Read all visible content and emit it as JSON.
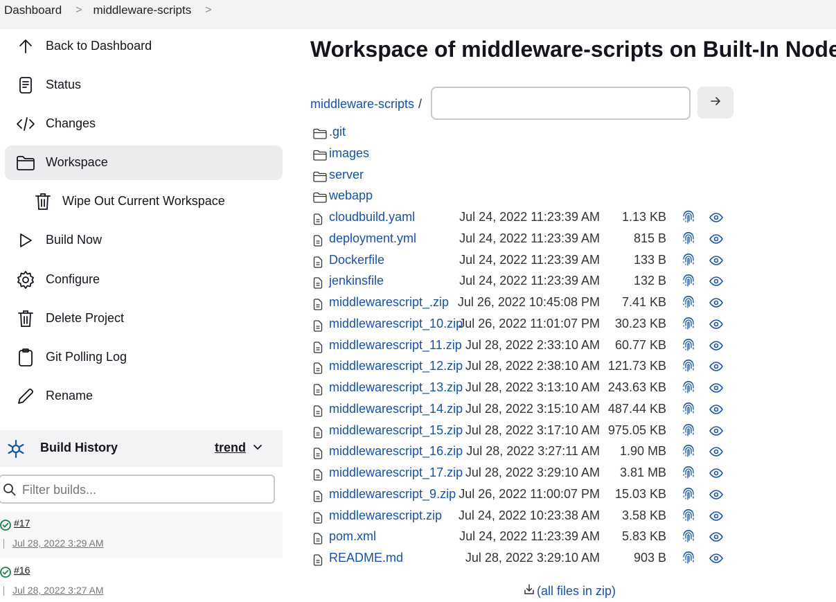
{
  "breadcrumb": {
    "items": [
      "Dashboard",
      "middleware-scripts"
    ],
    "separator": ">"
  },
  "sidebar": {
    "items": [
      {
        "label": "Back to Dashboard",
        "icon": "arrow-up-icon"
      },
      {
        "label": "Status",
        "icon": "document-icon"
      },
      {
        "label": "Changes",
        "icon": "code-icon"
      },
      {
        "label": "Workspace",
        "icon": "folder-icon"
      },
      {
        "label": "Wipe Out Current Workspace",
        "icon": "trash-icon"
      },
      {
        "label": "Build Now",
        "icon": "play-icon"
      },
      {
        "label": "Configure",
        "icon": "gear-icon"
      },
      {
        "label": "Delete Project",
        "icon": "trash-icon"
      },
      {
        "label": "Git Polling Log",
        "icon": "clipboard-icon"
      },
      {
        "label": "Rename",
        "icon": "pencil-icon"
      }
    ],
    "active": "Workspace"
  },
  "build_history": {
    "title": "Build History",
    "trend_label": "trend",
    "filter_placeholder": "Filter builds...",
    "builds": [
      {
        "number": "#17",
        "date": "Jul 28, 2022 3:29 AM",
        "status": "success"
      },
      {
        "number": "#16",
        "date": "Jul 28, 2022 3:27 AM",
        "status": "success"
      }
    ]
  },
  "main": {
    "title": "Workspace of middleware-scripts on Built-In Node",
    "root_link": "middleware-scripts",
    "path_separator": "/",
    "path_input_value": "",
    "folders": [
      ".git",
      "images",
      "server",
      "webapp"
    ],
    "files": [
      {
        "name": "cloudbuild.yaml",
        "date": "Jul 24, 2022 11:23:39 AM",
        "size": "1.13 KB"
      },
      {
        "name": "deployment.yml",
        "date": "Jul 24, 2022 11:23:39 AM",
        "size": "815 B"
      },
      {
        "name": "Dockerfile",
        "date": "Jul 24, 2022 11:23:39 AM",
        "size": "133 B"
      },
      {
        "name": "jenkinsfile",
        "date": "Jul 24, 2022 11:23:39 AM",
        "size": "132 B"
      },
      {
        "name": "middlewarescript_.zip",
        "date": "Jul 26, 2022 10:45:08 PM",
        "size": "7.41 KB"
      },
      {
        "name": "middlewarescript_10.zip",
        "date": "Jul 26, 2022 11:01:07 PM",
        "size": "30.23 KB"
      },
      {
        "name": "middlewarescript_11.zip",
        "date": "Jul 28, 2022 2:33:10 AM",
        "size": "60.77 KB"
      },
      {
        "name": "middlewarescript_12.zip",
        "date": "Jul 28, 2022 2:38:10 AM",
        "size": "121.73 KB"
      },
      {
        "name": "middlewarescript_13.zip",
        "date": "Jul 28, 2022 3:13:10 AM",
        "size": "243.63 KB"
      },
      {
        "name": "middlewarescript_14.zip",
        "date": "Jul 28, 2022 3:15:10 AM",
        "size": "487.44 KB"
      },
      {
        "name": "middlewarescript_15.zip",
        "date": "Jul 28, 2022 3:17:10 AM",
        "size": "975.05 KB"
      },
      {
        "name": "middlewarescript_16.zip",
        "date": "Jul 28, 2022 3:27:11 AM",
        "size": "1.90 MB"
      },
      {
        "name": "middlewarescript_17.zip",
        "date": "Jul 28, 2022 3:29:10 AM",
        "size": "3.81 MB"
      },
      {
        "name": "middlewarescript_9.zip",
        "date": "Jul 26, 2022 11:00:07 PM",
        "size": "15.03 KB"
      },
      {
        "name": "middlewarescript.zip",
        "date": "Jul 24, 2022 10:23:38 AM",
        "size": "3.58 KB"
      },
      {
        "name": "pom.xml",
        "date": "Jul 24, 2022 11:23:39 AM",
        "size": "5.83 KB"
      },
      {
        "name": "README.md",
        "date": "Jul 28, 2022 3:29:10 AM",
        "size": "903 B"
      }
    ],
    "zip_link": "(all files in zip)"
  },
  "colors": {
    "link": "#1652a6",
    "success": "#138347",
    "sidebar_active_bg": "#ececef",
    "header_bg": "#f3f3f5"
  }
}
